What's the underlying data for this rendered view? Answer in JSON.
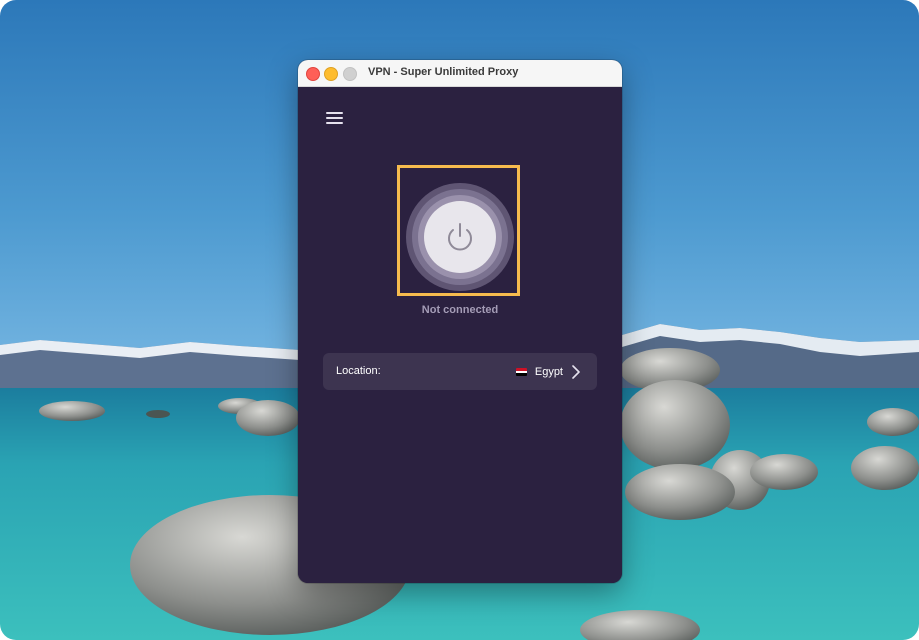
{
  "window": {
    "title": "VPN - Super Unlimited Proxy"
  },
  "app": {
    "menu_icon": "hamburger-menu-icon",
    "power_icon": "power-icon",
    "status": "Not connected",
    "location": {
      "label": "Location:",
      "value": "Egypt",
      "flag_icon": "egypt-flag-icon",
      "chevron_icon": "chevron-right-icon"
    }
  },
  "colors": {
    "app_background": "#2b2140",
    "location_bar": "#3d3450",
    "highlight_border": "#f6bb4e",
    "status_text": "#a49cb6"
  }
}
